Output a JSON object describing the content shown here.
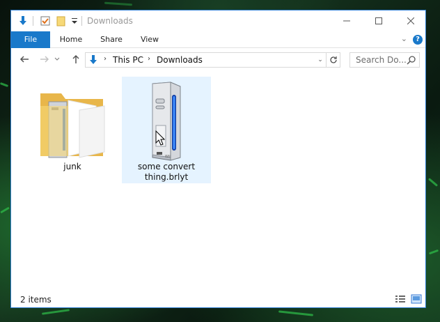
{
  "window": {
    "title": "Downloads"
  },
  "ribbon": {
    "tabs": [
      "File",
      "Home",
      "Share",
      "View"
    ]
  },
  "address": {
    "crumbs": [
      "This PC",
      "Downloads"
    ]
  },
  "search": {
    "placeholder": "Search Do..."
  },
  "items": [
    {
      "label": "junk",
      "type": "folder",
      "icon": "folder-icon"
    },
    {
      "label": "some convert thing.brlyt",
      "type": "file",
      "icon": "wii-console-icon",
      "selected": true
    }
  ],
  "status": {
    "count_text": "2 items"
  },
  "colors": {
    "accent": "#1979ca",
    "selection": "#e5f3ff",
    "folder": "#f5d26b"
  }
}
